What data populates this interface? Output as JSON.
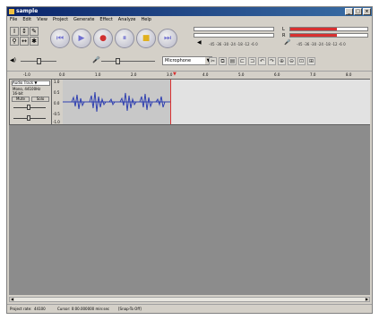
{
  "window": {
    "title": "sample"
  },
  "menu": [
    "File",
    "Edit",
    "View",
    "Project",
    "Generate",
    "Effect",
    "Analyze",
    "Help"
  ],
  "transport": [
    {
      "name": "skip-start",
      "glyph": "⏮"
    },
    {
      "name": "play",
      "glyph": "▶"
    },
    {
      "name": "record",
      "glyph": "●"
    },
    {
      "name": "pause",
      "glyph": "⏸"
    },
    {
      "name": "stop",
      "glyph": "■"
    },
    {
      "name": "skip-end",
      "glyph": "⏭"
    }
  ],
  "meters": {
    "left_label": "L",
    "right_label": "R",
    "peak_fraction": 0.6,
    "scale": "-45  -36  -30  -24  -18  -12  -6  0"
  },
  "input_source": "Microphone",
  "ruler": [
    "-1.0",
    "0.0",
    "1.0",
    "2.0",
    "3.0",
    "4.0",
    "5.0",
    "6.0",
    "7.0",
    "8.0",
    "9.0"
  ],
  "track": {
    "name": "Audio Track",
    "format": "Mono, 44100Hz",
    "bits": "16-bit",
    "mute": "Mute",
    "solo": "Solo"
  },
  "vscale": [
    "1.0",
    "0.5",
    "0.0",
    "-0.5",
    "-1.0"
  ],
  "status": {
    "rate_label": "Project rate:",
    "rate": "44100",
    "cursor": "Cursor: 0:00.000000 min:sec",
    "snap": "[Snap-To Off]"
  },
  "colors": {
    "waveform": "#3040b0",
    "selection": "#c8c8c8",
    "cursor": "#d83030"
  }
}
